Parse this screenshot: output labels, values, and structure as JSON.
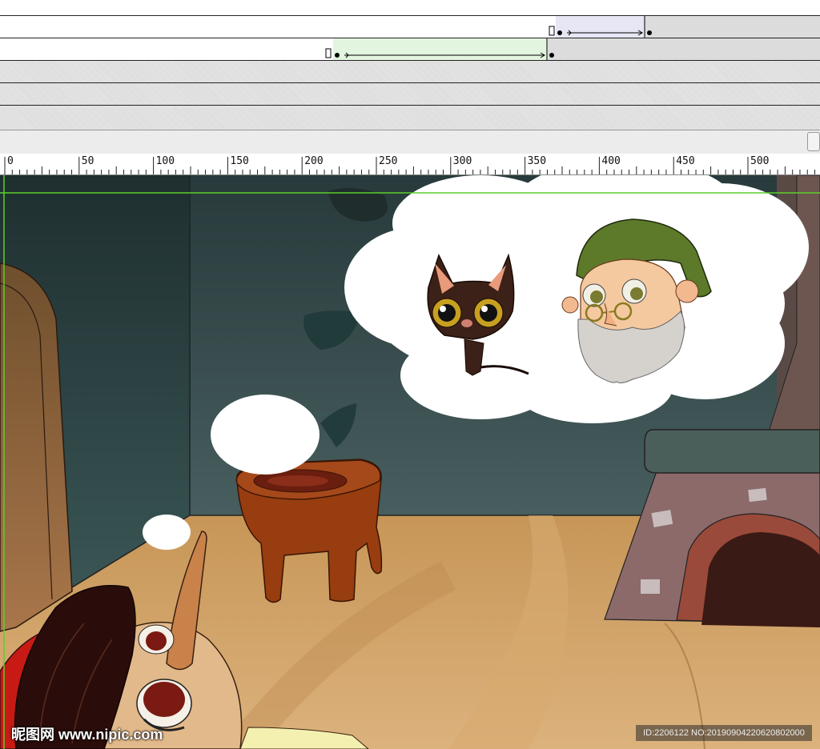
{
  "timeline": {
    "layer_count": 5,
    "tween_1": {
      "fill": "#e6e6f5"
    },
    "tween_2": {
      "fill": "#e2f5de"
    }
  },
  "ruler": {
    "labels": [
      "0",
      "50",
      "100",
      "150",
      "200",
      "250",
      "300",
      "350",
      "400",
      "450",
      "500"
    ]
  },
  "watermark": {
    "site": "昵图网 www.nipic.com",
    "id": "ID:2206122 NO:20190904220620802000"
  },
  "colors": {
    "wall_dark": "#2e4443",
    "floor": "#c9995e",
    "guide": "#5ccf2a"
  }
}
